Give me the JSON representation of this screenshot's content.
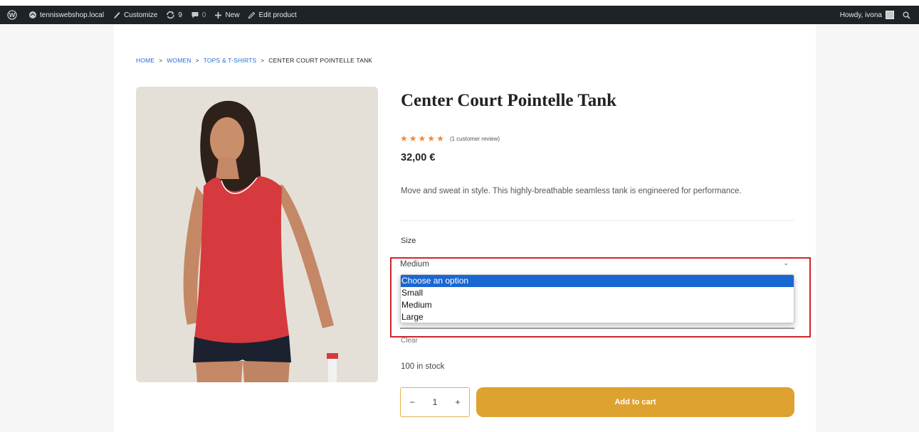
{
  "adminbar": {
    "site_name": "tenniswebshop.local",
    "customize": "Customize",
    "updates_count": "9",
    "comments_count": "0",
    "new_label": "New",
    "edit_label": "Edit product",
    "greeting": "Howdy, ivona",
    "icons": [
      "wordpress-icon",
      "dashboard-icon",
      "brush-icon",
      "updates-icon",
      "comment-icon",
      "plus-icon",
      "pencil-icon",
      "avatar",
      "search-icon"
    ]
  },
  "breadcrumb": {
    "items": [
      "HOME",
      "WOMEN",
      "TOPS & T-SHIRTS"
    ],
    "current": "CENTER COURT POINTELLE TANK",
    "separator": ">"
  },
  "product": {
    "title": "Center Court Pointelle Tank",
    "rating": 5,
    "review_text": "(1 customer review)",
    "price": "32,00 €",
    "description": "Move and sweat in style. This highly-breathable seamless tank is engineered for performance.",
    "size_label": "Size",
    "selected_size": "Medium",
    "options": [
      "Choose an option",
      "Small",
      "Medium",
      "Large"
    ],
    "highlighted_option": "Choose an option",
    "clear_label": "Clear",
    "stock": "100 in stock",
    "quantity": "1",
    "qty_minus": "−",
    "qty_plus": "+",
    "add_to_cart": "Add to cart"
  },
  "colors": {
    "adminbar_bg": "#1d2327",
    "link": "#2a6ad8",
    "star": "#ee8a3c",
    "button": "#dea230",
    "highlight_box": "#d0242b",
    "option_selected": "#1a66d2"
  }
}
